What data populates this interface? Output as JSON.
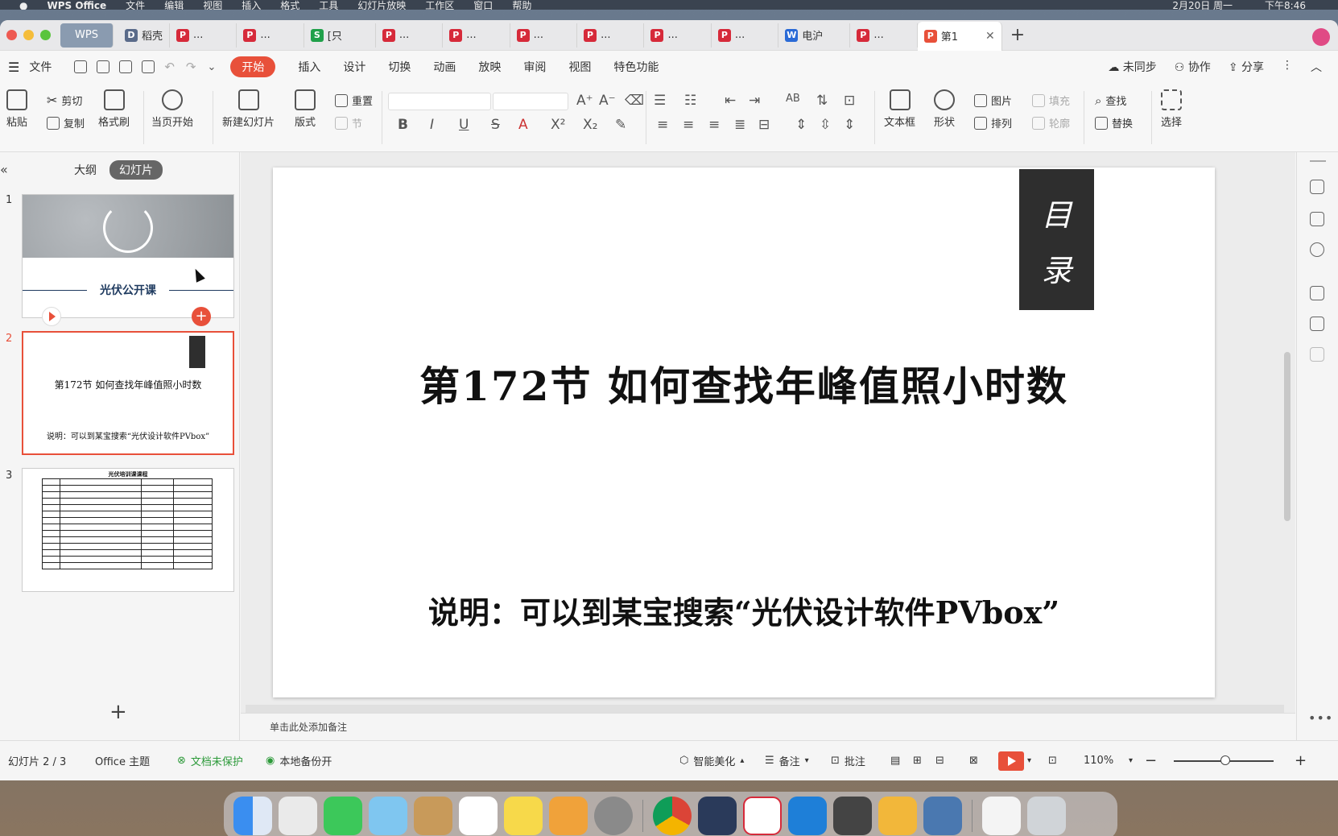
{
  "macmenu": {
    "app": "WPS Office",
    "items": [
      "文件",
      "编辑",
      "视图",
      "插入",
      "格式",
      "工具",
      "幻灯片放映",
      "工作区",
      "窗口",
      "帮助"
    ],
    "date": "2月20日 周一",
    "time": "下午8:46"
  },
  "tabs": [
    {
      "label": "WPS",
      "kind": "home",
      "color": "#8a9bb0"
    },
    {
      "label": "稻壳",
      "kind": "docer",
      "color": "#5a6b8a"
    },
    {
      "label": "...",
      "kind": "ppt",
      "color": "#d62a3a"
    },
    {
      "label": "...",
      "kind": "ppt",
      "color": "#d62a3a"
    },
    {
      "label": "[只",
      "kind": "sheet",
      "color": "#20a04a"
    },
    {
      "label": "...",
      "kind": "ppt",
      "color": "#d62a3a"
    },
    {
      "label": "...",
      "kind": "ppt",
      "color": "#d62a3a"
    },
    {
      "label": "...",
      "kind": "ppt",
      "color": "#d62a3a"
    },
    {
      "label": "...",
      "kind": "ppt",
      "color": "#d62a3a"
    },
    {
      "label": "...",
      "kind": "ppt",
      "color": "#d62a3a"
    },
    {
      "label": "...",
      "kind": "ppt",
      "color": "#d62a3a"
    },
    {
      "label": "电沪",
      "kind": "doc",
      "color": "#2a6ad6"
    },
    {
      "label": "...",
      "kind": "ppt",
      "color": "#d62a3a"
    },
    {
      "label": "第1",
      "kind": "ppt",
      "color": "#e8503a",
      "active": true
    }
  ],
  "menu": {
    "file": "文件",
    "items": [
      "开始",
      "插入",
      "设计",
      "切换",
      "动画",
      "放映",
      "审阅",
      "视图",
      "特色功能"
    ],
    "active": "开始",
    "right": {
      "sync": "未同步",
      "collab": "协作",
      "share": "分享"
    }
  },
  "ribbon": {
    "paste": "粘贴",
    "cut": "剪切",
    "copy": "复制",
    "format_painter": "格式刷",
    "from_current": "当页开始",
    "new_slide": "新建幻灯片",
    "layout": "版式",
    "reset": "重置",
    "section": "节",
    "textbox": "文本框",
    "shape": "形状",
    "picture": "图片",
    "arrange": "排列",
    "fill": "填充",
    "outline": "轮廓",
    "find": "查找",
    "replace": "替换",
    "select": "选择"
  },
  "leftpane": {
    "tab_outline": "大纲",
    "tab_slides": "幻灯片",
    "slides": [
      {
        "num": "1",
        "title": "光伏公开课"
      },
      {
        "num": "2",
        "title": "第172节 如何查找年峰值照小时数",
        "subtitle": "说明：可以到某宝搜索“光伏设计软件PVbox”",
        "badge": "目录"
      },
      {
        "num": "3",
        "title": "光伏培训课课程"
      }
    ]
  },
  "slide": {
    "badge_line1": "目",
    "badge_line2": "录",
    "title": "第172节 如何查找年峰值照小时数",
    "subtitle": "说明：可以到某宝搜索“光伏设计软件PVbox”"
  },
  "notes_placeholder": "单击此处添加备注",
  "status": {
    "slide_count": "幻灯片 2 / 3",
    "theme": "Office 主题",
    "protect": "文档未保护",
    "backup": "本地备份开",
    "beautify": "智能美化",
    "notes": "备注",
    "comments": "批注",
    "zoom": "110%"
  },
  "colors": {
    "accent": "#e8503a",
    "dark_box": "#2e2e2e",
    "thumb_title": "#1e3a5f",
    "green": "#2d9a3a"
  },
  "dock_apps": [
    "finder-icon",
    "launchpad-icon",
    "messages-icon",
    "maps-icon",
    "contacts-icon",
    "reminders-icon",
    "notes-icon",
    "pages-icon",
    "settings-icon",
    "chrome-icon",
    "parallels-icon",
    "wps-icon",
    "windows-icon",
    "unity-icon",
    "folder-icon",
    "python-icon",
    "document-icon",
    "trash-icon"
  ]
}
